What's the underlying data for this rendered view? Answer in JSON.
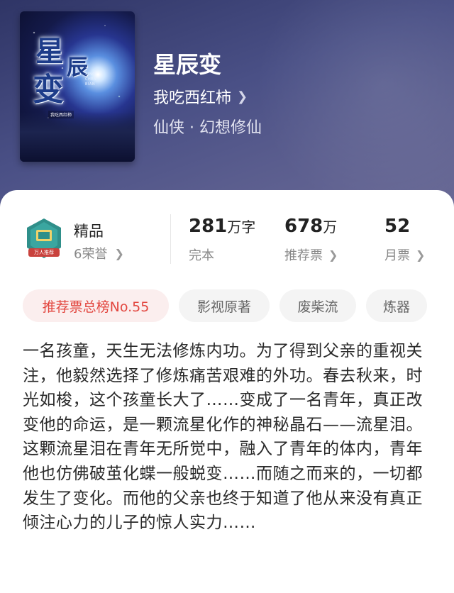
{
  "book": {
    "title": "星辰变",
    "author": "我吃西红柿",
    "genre": "仙侠 · 幻想修仙",
    "cover": {
      "title_chars": [
        "星",
        "辰",
        "变"
      ],
      "pinyin_lines": [
        "XING",
        "CHEN",
        "BIAN"
      ],
      "author": "我吃西红柿"
    }
  },
  "quality": {
    "label": "精品",
    "honor": "6荣誉",
    "badge_text": "万人推荐"
  },
  "stats": {
    "words": {
      "value": "281",
      "unit": "万字",
      "label": "完本"
    },
    "recommend": {
      "value": "678",
      "unit": "万",
      "label": "推荐票"
    },
    "monthly": {
      "value": "52",
      "label": "月票"
    }
  },
  "tags": [
    "推荐票总榜No.55",
    "影视原著",
    "废柴流",
    "炼器"
  ],
  "description": "一名孩童，天生无法修炼内功。为了得到父亲的重视关注，他毅然选择了修炼痛苦艰难的外功。春去秋来，时光如梭，这个孩童长大了……变成了一名青年，真正改变他的命运，是一颗流星化作的神秘晶石——流星泪。这颗流星泪在青年无所觉中，融入了青年的体内，青年他也仿佛破茧化蝶一般蜕变……而随之而来的，一切都发生了变化。而他的父亲也终于知道了他从来没有真正倾注心力的儿子的惊人实力……",
  "colors": {
    "header": "#4a5086",
    "accent_red": "#e2453e",
    "badge_teal": "#2f8f8a"
  }
}
